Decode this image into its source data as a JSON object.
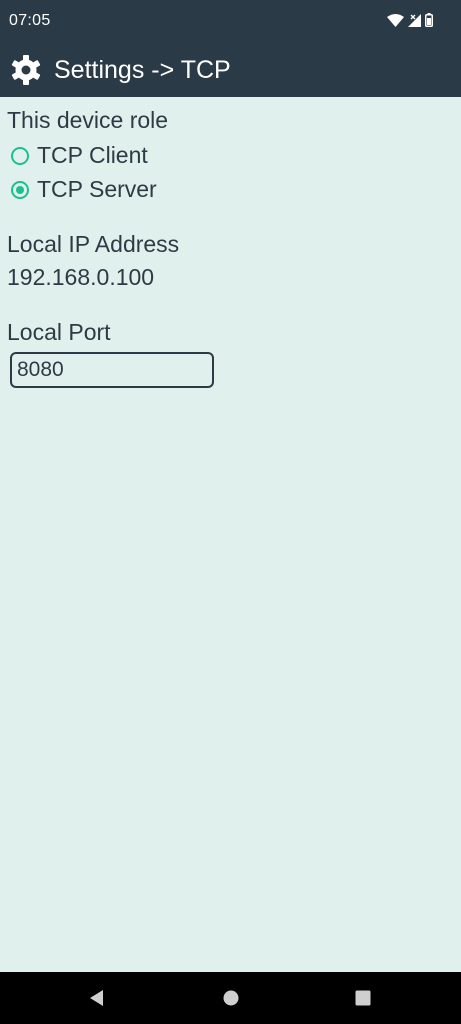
{
  "status_bar": {
    "time": "07:05",
    "icons": [
      "wifi-icon",
      "signal-icon",
      "battery-icon"
    ]
  },
  "app_bar": {
    "icon": "gear-icon",
    "title": "Settings -> TCP"
  },
  "role": {
    "heading": "This device role",
    "options": [
      {
        "label": "TCP Client",
        "selected": false
      },
      {
        "label": "TCP Server",
        "selected": true
      }
    ]
  },
  "local_ip": {
    "label": "Local IP Address",
    "value": "192.168.0.100"
  },
  "local_port": {
    "label": "Local Port",
    "value": "8080"
  },
  "nav_bar": {
    "buttons": [
      "back-icon",
      "home-icon",
      "recents-icon"
    ]
  },
  "colors": {
    "bar": "#2b3a47",
    "background": "#e0f0ed",
    "accent": "#1cbf8e",
    "text": "#2e3b47"
  }
}
